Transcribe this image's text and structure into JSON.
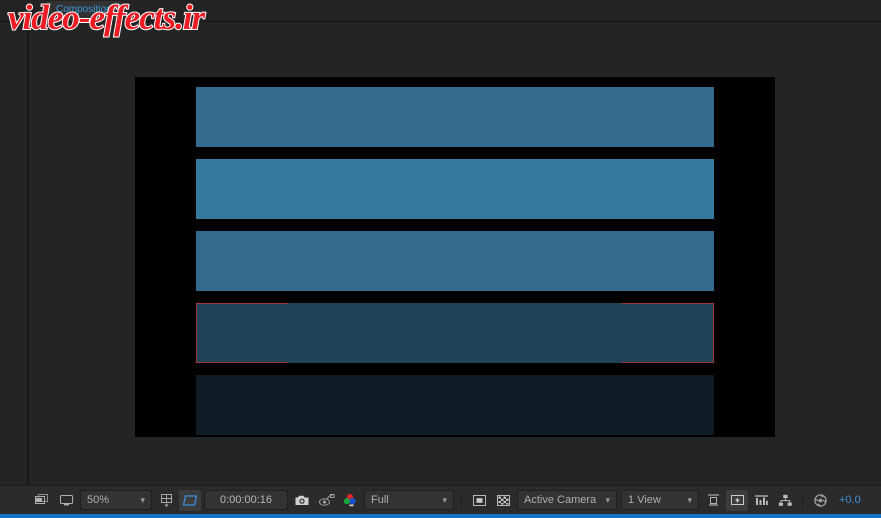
{
  "panel": {
    "tab_label": "Composition"
  },
  "watermark": {
    "text": "video-effects.ir",
    "color": "#ed1c24",
    "outline_color": "#ffffff"
  },
  "composition": {
    "background_color": "#000000",
    "bars": [
      {
        "name": "bar-1",
        "color": "#356b8e",
        "selected": false
      },
      {
        "name": "bar-2",
        "color": "#34799e",
        "selected": false
      },
      {
        "name": "bar-3",
        "color": "#336a8d",
        "selected": false
      },
      {
        "name": "bar-4",
        "color": "#1f4256",
        "selected": true
      },
      {
        "name": "bar-5",
        "color": "#101c25",
        "selected": false
      }
    ],
    "selection_outline_color": "#a03a3c"
  },
  "toolbar": {
    "zoom_level": "50%",
    "timecode": "0:00:00:16",
    "resolution": "Full",
    "camera": "Active Camera",
    "views": "1 View",
    "exposure": "+0.0",
    "exposure_color": "#3f8ed8",
    "icons": {
      "always_preview": "always-preview-this-view-icon",
      "main_viewer": "main-viewer-icon",
      "region_of_interest": "region-of-interest-icon",
      "toggle_mask_paths": "toggle-mask-paths-icon",
      "snapshot": "take-snapshot-icon",
      "show_snapshot": "show-snapshot-icon",
      "show_channel": "show-channel-icon",
      "toggle_transparency_grid": "toggle-transparency-grid-icon",
      "toggle_mask_overlay": "toggle-mask-overlay-icon",
      "toggle_transparency": "toggle-transparency-icon",
      "fast_previews": "fast-previews-icon",
      "timeline": "timeline-icon",
      "flowchart": "flowchart-icon",
      "reset_exposure": "reset-exposure-icon"
    }
  }
}
